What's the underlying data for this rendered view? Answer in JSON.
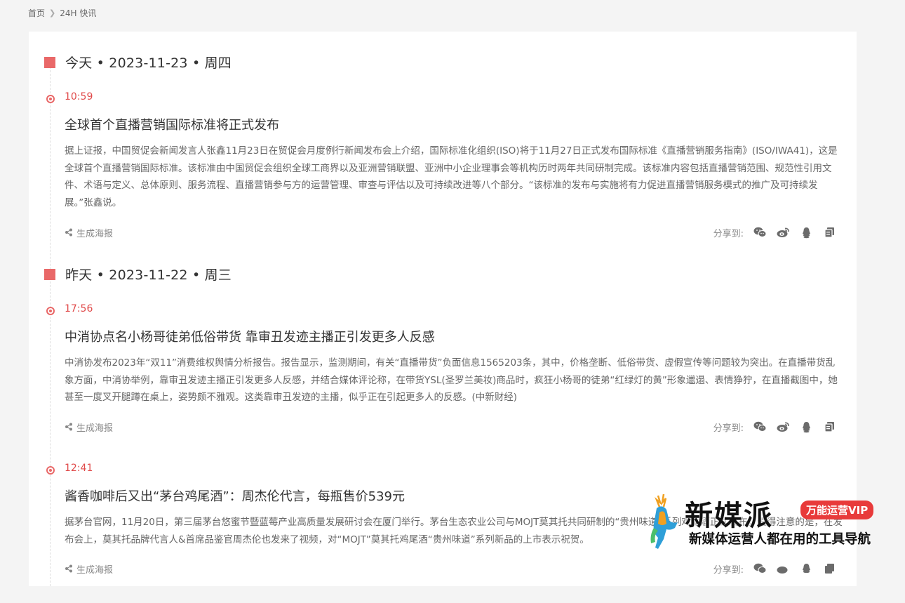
{
  "breadcrumb": {
    "home": "首页",
    "current": "24H 快讯"
  },
  "days": [
    {
      "label": "今天 • 2023-11-23 • 周四"
    },
    {
      "label": "昨天 • 2023-11-22 • 周三"
    }
  ],
  "news": [
    {
      "time": "10:59",
      "title": "全球首个直播营销国际标准将正式发布",
      "body": "据上证报，中国贸促会新闻发言人张鑫11月23日在贸促会月度例行新闻发布会上介绍，国际标准化组织(ISO)将于11月27日正式发布国际标准《直播营销服务指南》(ISO/IWA41)，这是全球首个直播营销国际标准。该标准由中国贸促会组织全球工商界以及亚洲营销联盟、亚洲中小企业理事会等机构历时两年共同研制完成。该标准内容包括直播营销范围、规范性引用文件、术语与定义、总体原则、服务流程、直播营销参与方的运营管理、审查与评估以及可持续改进等八个部分。“该标准的发布与实施将有力促进直播营销服务模式的推广及可持续发展。”张鑫说。"
    },
    {
      "time": "17:56",
      "title": "中消协点名小杨哥徒弟低俗带货 靠审丑发迹主播正引发更多人反感",
      "body": "中消协发布2023年“双11”消费维权舆情分析报告。报告显示，监测期间，有关“直播带货”负面信息1565203条，其中，价格垄断、低俗带货、虚假宣传等问题较为突出。在直播带货乱象方面，中消协举例，靠审丑发迹主播正引发更多人反感，并结合媒体评论称，在带货YSL(圣罗兰美妆)商品时，疯狂小杨哥的徒弟“红绿灯的黄”形象邋遢、表情狰狞，在直播截图中，她甚至一度叉开腿蹲在桌上，姿势颇不雅观。这类靠审丑发迹的主播，似乎正在引起更多人的反感。(中新财经)"
    },
    {
      "time": "12:41",
      "title": "酱香咖啡后又出“茅台鸡尾酒”：周杰伦代言，每瓶售价539元",
      "body": "据茅台官网，11月20日，第三届茅台悠蜜节暨蓝莓产业高质量发展研讨会在厦门举行。茅台生态农业公司与MOJT莫其托共同研制的“贵州味道”系列鸡尾酒正式发布。值得注意的是，在发布会上，莫其托品牌代言人&首席品鉴官周杰伦也发来了视频，对“MOJT”莫其托鸡尾酒“贵州味道”系列新品的上市表示祝贺。"
    }
  ],
  "actions": {
    "poster_label": "生成海报",
    "share_label": "分享到:",
    "share_icons": [
      "wechat-icon",
      "weibo-icon",
      "qq-icon",
      "copy-icon"
    ]
  },
  "watermark": {
    "brand": "新媒派",
    "badge": "万能运营VIP",
    "slogan": "新媒体运营人都在用的工具导航"
  },
  "colors": {
    "accent": "#e96868",
    "time": "#e04b4b",
    "badge": "#e83a3a"
  }
}
